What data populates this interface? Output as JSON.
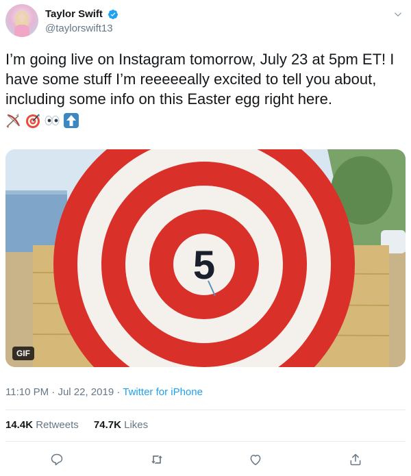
{
  "user": {
    "display_name": "Taylor Swift",
    "handle": "@taylorswift13",
    "verified": true
  },
  "tweet": {
    "text": "I’m going live on Instagram tomorrow, July 23 at 5pm ET! I have some stuff I’m reeeeeally excited to tell you about, including some info on this Easter egg right here.",
    "emojis": [
      "bow-and-arrow-icon",
      "direct-hit-icon",
      "eyes-icon",
      "up-arrow-icon"
    ]
  },
  "media": {
    "badge": "GIF",
    "target_number": "5"
  },
  "meta": {
    "time": "11:10 PM",
    "separator": " · ",
    "date": "Jul 22, 2019",
    "source": "Twitter for iPhone"
  },
  "stats": {
    "retweets_count": "14.4K",
    "retweets_label": "Retweets",
    "likes_count": "74.7K",
    "likes_label": "Likes"
  },
  "actions": [
    "reply-icon",
    "retweet-icon",
    "like-icon",
    "share-icon"
  ],
  "colors": {
    "accent": "#1da1f2",
    "text": "#14171a",
    "muted": "#657786",
    "target_red": "#d9302a"
  }
}
